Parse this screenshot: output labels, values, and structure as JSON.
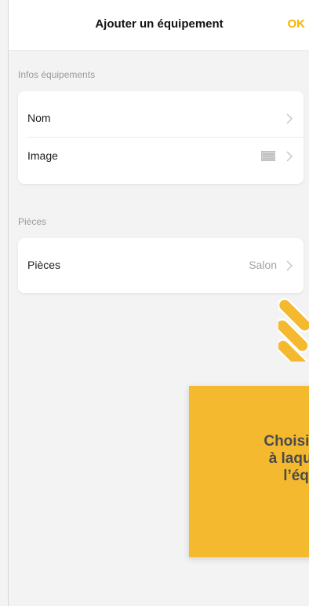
{
  "header": {
    "title": "Ajouter un équipement",
    "ok_label": "OK"
  },
  "sections": {
    "infos_label": "Infos équipements",
    "rooms_label": "Pièces"
  },
  "infos": {
    "name_label": "Nom",
    "image_label": "Image"
  },
  "rooms": {
    "room_label": "Pièces",
    "room_value": "Salon"
  },
  "tutorial": {
    "line1": "Choisissez",
    "line2": "à laquelle",
    "line3": "l’équi",
    "background": "#f5b930"
  },
  "icons": {
    "chevron": "chevron-right-icon",
    "image": "image-icon",
    "pointer": "pointing-hand-icon"
  },
  "colors": {
    "accent": "#f3b300",
    "text": "#1c1c1c",
    "muted": "#a3a3a3",
    "page_bg": "#f3f3f3"
  }
}
